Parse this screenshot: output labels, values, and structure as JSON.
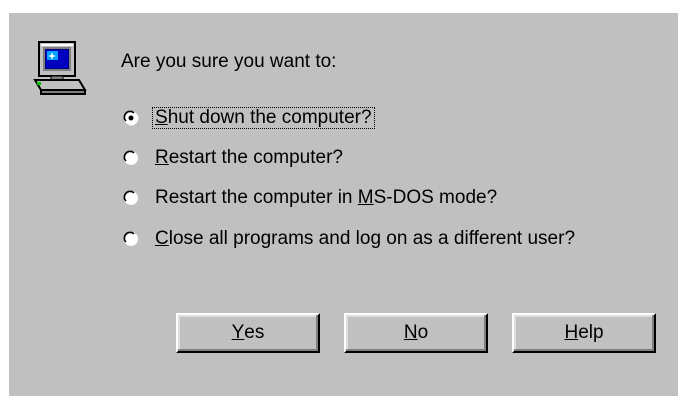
{
  "dialog": {
    "question": "Are you sure you want to:",
    "icon": "computer-icon",
    "selected_option": 0,
    "options": [
      {
        "pre": "",
        "key": "S",
        "post": "hut down the computer?"
      },
      {
        "pre": "",
        "key": "R",
        "post": "estart the computer?"
      },
      {
        "pre": "Restart the computer in ",
        "key": "M",
        "post": "S-DOS mode?"
      },
      {
        "pre": "",
        "key": "C",
        "post": "lose all programs and log on as a different user?"
      }
    ],
    "buttons": {
      "yes": {
        "pre": "",
        "key": "Y",
        "post": "es"
      },
      "no": {
        "pre": "",
        "key": "N",
        "post": "o"
      },
      "help": {
        "pre": "",
        "key": "H",
        "post": "elp"
      }
    }
  }
}
